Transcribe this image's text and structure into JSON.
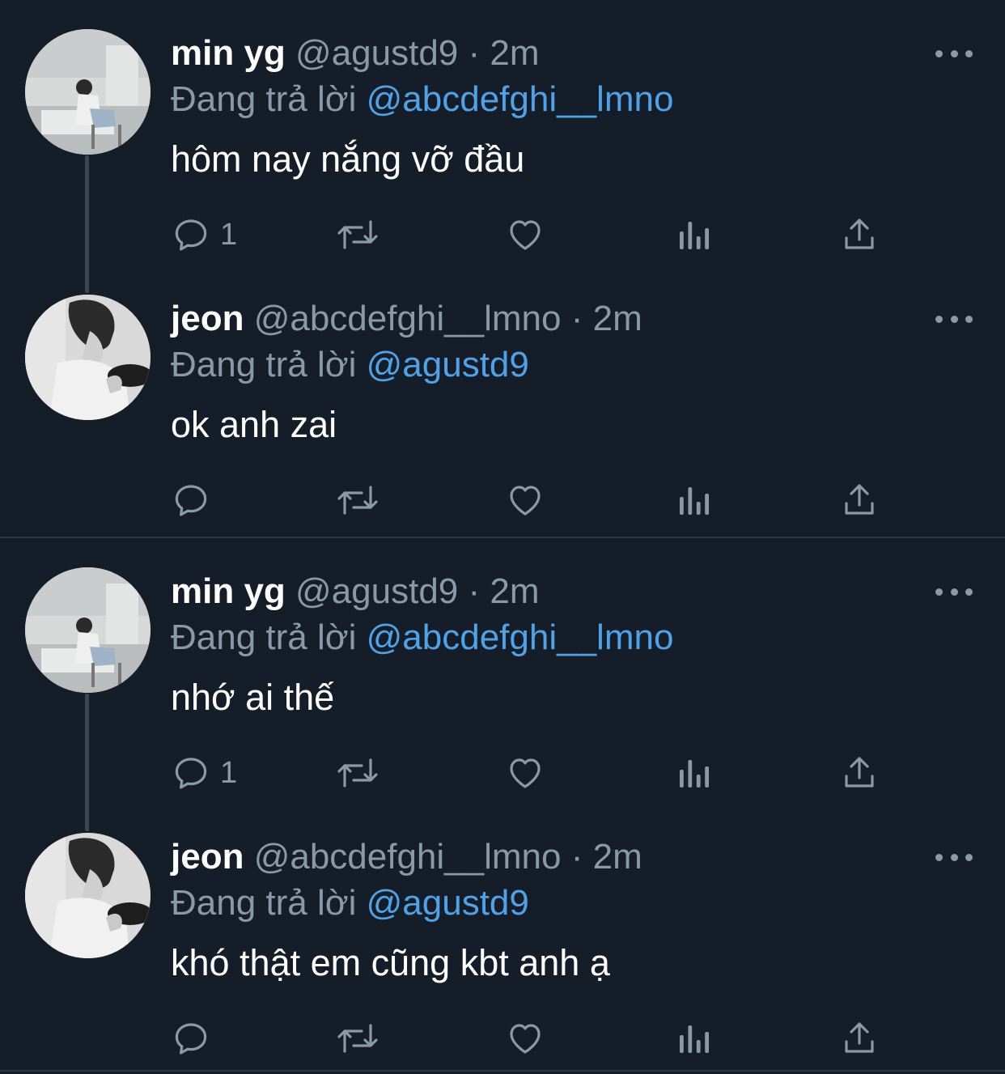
{
  "threads": [
    {
      "tweets": [
        {
          "name": "min yg",
          "handle": "@agustd9",
          "separator": "·",
          "time": "2m",
          "reply_prefix": "Đang trả lời",
          "reply_to": "@abcdefghi__lmno",
          "text": "hôm nay nắng vỡ đầu",
          "reply_count": "1",
          "avatar_icon": "avatar-photo"
        },
        {
          "name": "jeon",
          "handle": "@abcdefghi__lmno",
          "separator": "·",
          "time": "2m",
          "reply_prefix": "Đang trả lời",
          "reply_to": "@agustd9",
          "text": "ok anh zai",
          "reply_count": "",
          "avatar_icon": "avatar-photo"
        }
      ]
    },
    {
      "tweets": [
        {
          "name": "min yg",
          "handle": "@agustd9",
          "separator": "·",
          "time": "2m",
          "reply_prefix": "Đang trả lời",
          "reply_to": "@abcdefghi__lmno",
          "text": "nhớ ai thế",
          "reply_count": "1",
          "avatar_icon": "avatar-photo"
        },
        {
          "name": "jeon",
          "handle": "@abcdefghi__lmno",
          "separator": "·",
          "time": "2m",
          "reply_prefix": "Đang trả lời",
          "reply_to": "@agustd9",
          "text": "khó thật em cũng kbt anh ạ",
          "reply_count": "",
          "avatar_icon": "avatar-photo"
        }
      ]
    }
  ],
  "colors": {
    "background": "#151d28",
    "muted": "#8b98a5",
    "link": "#4ea3e8",
    "divider": "#2e3742"
  }
}
